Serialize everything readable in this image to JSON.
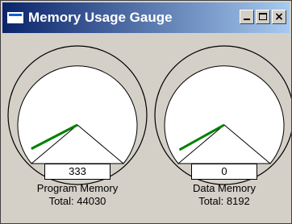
{
  "window": {
    "title": "Memory Usage Gauge",
    "icon": "app-window-icon",
    "controls": {
      "minimize": "minimize",
      "maximize": "maximize",
      "close": "×"
    }
  },
  "gauges": [
    {
      "value": "333",
      "title": "Program Memory",
      "total": "Total: 44030",
      "fraction": 0.0076,
      "needle_color": "#008000"
    },
    {
      "value": "0",
      "title": "Data Memory",
      "total": "Total: 8192",
      "fraction": 0,
      "needle_color": "#008000"
    }
  ],
  "colors": {
    "titlebar_start": "#0a246a",
    "titlebar_end": "#a6caf0",
    "face": "#d4d0c8",
    "dial": "#ffffff"
  }
}
